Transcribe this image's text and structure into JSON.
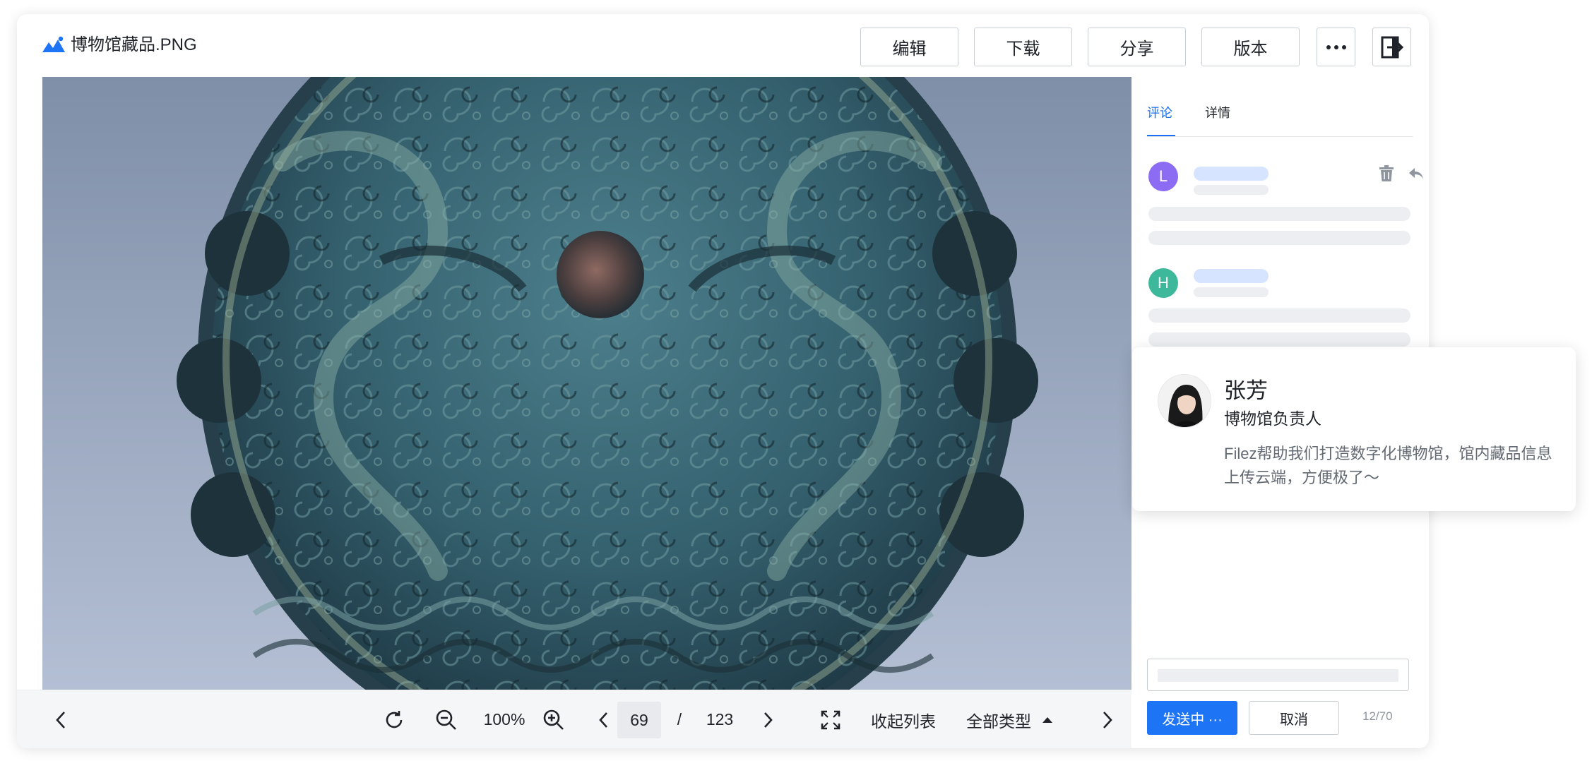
{
  "header": {
    "file_name": "博物馆藏品.PNG",
    "buttons": {
      "edit": "编辑",
      "download": "下载",
      "share": "分享",
      "version": "版本"
    },
    "icons": {
      "more": "more-dots-icon",
      "exit": "exit-icon",
      "logo": "mountain-logo-icon"
    }
  },
  "viewer": {
    "zoom": "100%",
    "current_page": "69",
    "page_separator": "/",
    "total_pages": "123",
    "collapse_list": "收起列表",
    "all_types": "全部类型"
  },
  "side_panel": {
    "tabs": [
      "评论",
      "详情"
    ],
    "active_tab": "评论",
    "comments": [
      {
        "avatar_letter": "L",
        "avatar_color": "#8c6cf2"
      },
      {
        "avatar_letter": "H",
        "avatar_color": "#3db89a"
      }
    ],
    "send_label": "发送中 ···",
    "cancel_label": "取消",
    "char_count": "12/70"
  },
  "testimonial": {
    "name": "张芳",
    "role": "博物馆负责人",
    "quote": "Filez帮助我们打造数字化博物馆，馆内藏品信息上传云端，方便极了～"
  },
  "colors": {
    "accent": "#1d74f5",
    "border": "#c9cdd4",
    "skeleton": "#eceef1",
    "skeleton_blue": "#d6e4ff"
  }
}
